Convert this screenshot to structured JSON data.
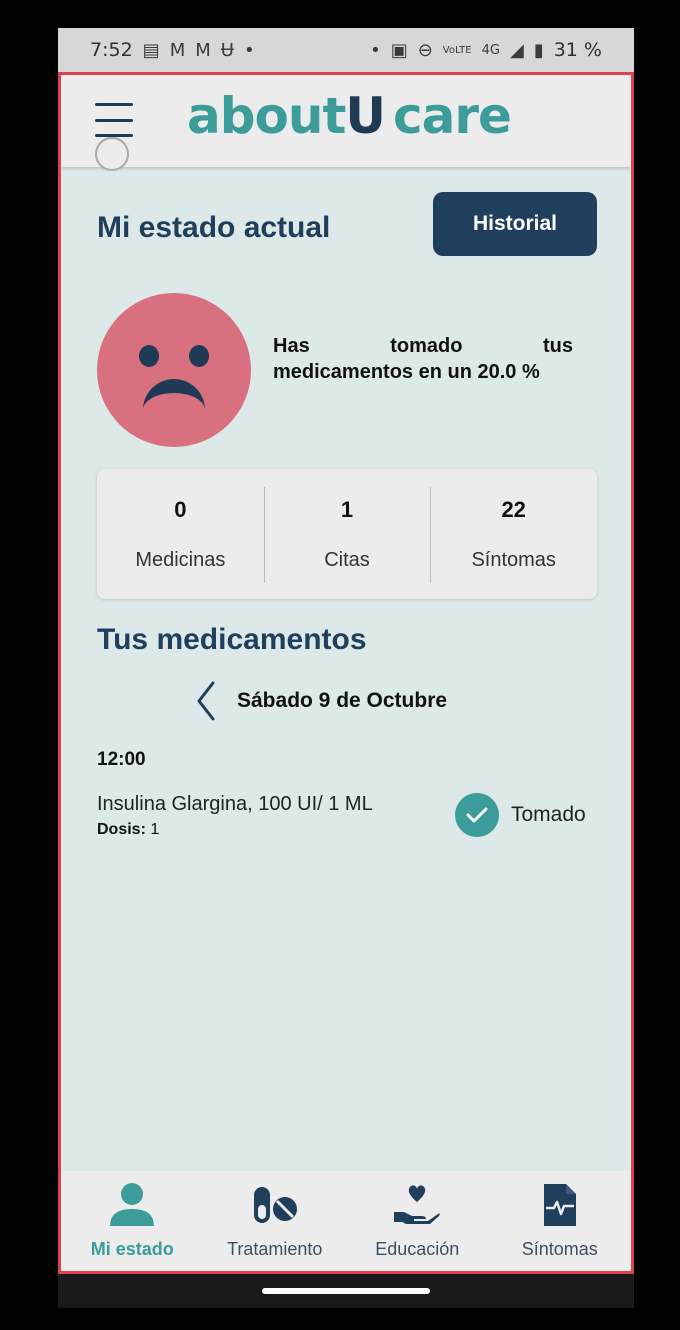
{
  "status_bar": {
    "time": "7:52",
    "network": "4G",
    "volte": "VoLTE",
    "battery": "31 %"
  },
  "header": {
    "logo_part1": "about",
    "logo_part2": "U",
    "logo_part3": "care",
    "menu_icon": "hamburger-menu-icon"
  },
  "status": {
    "title": "Mi estado actual",
    "history_button": "Historial",
    "mood": "sad",
    "adherence_line1_words": [
      "Has",
      "tomado",
      "tus"
    ],
    "adherence_line2": "medicamentos en un 20.0 %",
    "adherence_percent": 20.0
  },
  "stats": [
    {
      "value": "0",
      "label": "Medicinas"
    },
    {
      "value": "1",
      "label": "Citas"
    },
    {
      "value": "22",
      "label": "Síntomas"
    }
  ],
  "medications": {
    "title": "Tus medicamentos",
    "date": "Sábado 9 de Octubre",
    "time": "12:00",
    "item": {
      "name": "Insulina Glargina, 100 UI/ 1 ML",
      "dose_label": "Dosis:",
      "dose_value": "1",
      "status": "Tomado"
    }
  },
  "bottom_nav": [
    {
      "label": "Mi estado",
      "icon": "person-icon",
      "active": true
    },
    {
      "label": "Tratamiento",
      "icon": "pills-icon",
      "active": false
    },
    {
      "label": "Educación",
      "icon": "heart-hand-icon",
      "active": false
    },
    {
      "label": "Síntomas",
      "icon": "symptom-document-icon",
      "active": false
    }
  ],
  "colors": {
    "primary_dark": "#1f3f5c",
    "accent_teal": "#3b9c9a",
    "mood_red": "#d9707f",
    "background": "#dde8e8",
    "frame_border": "#d9434b"
  }
}
